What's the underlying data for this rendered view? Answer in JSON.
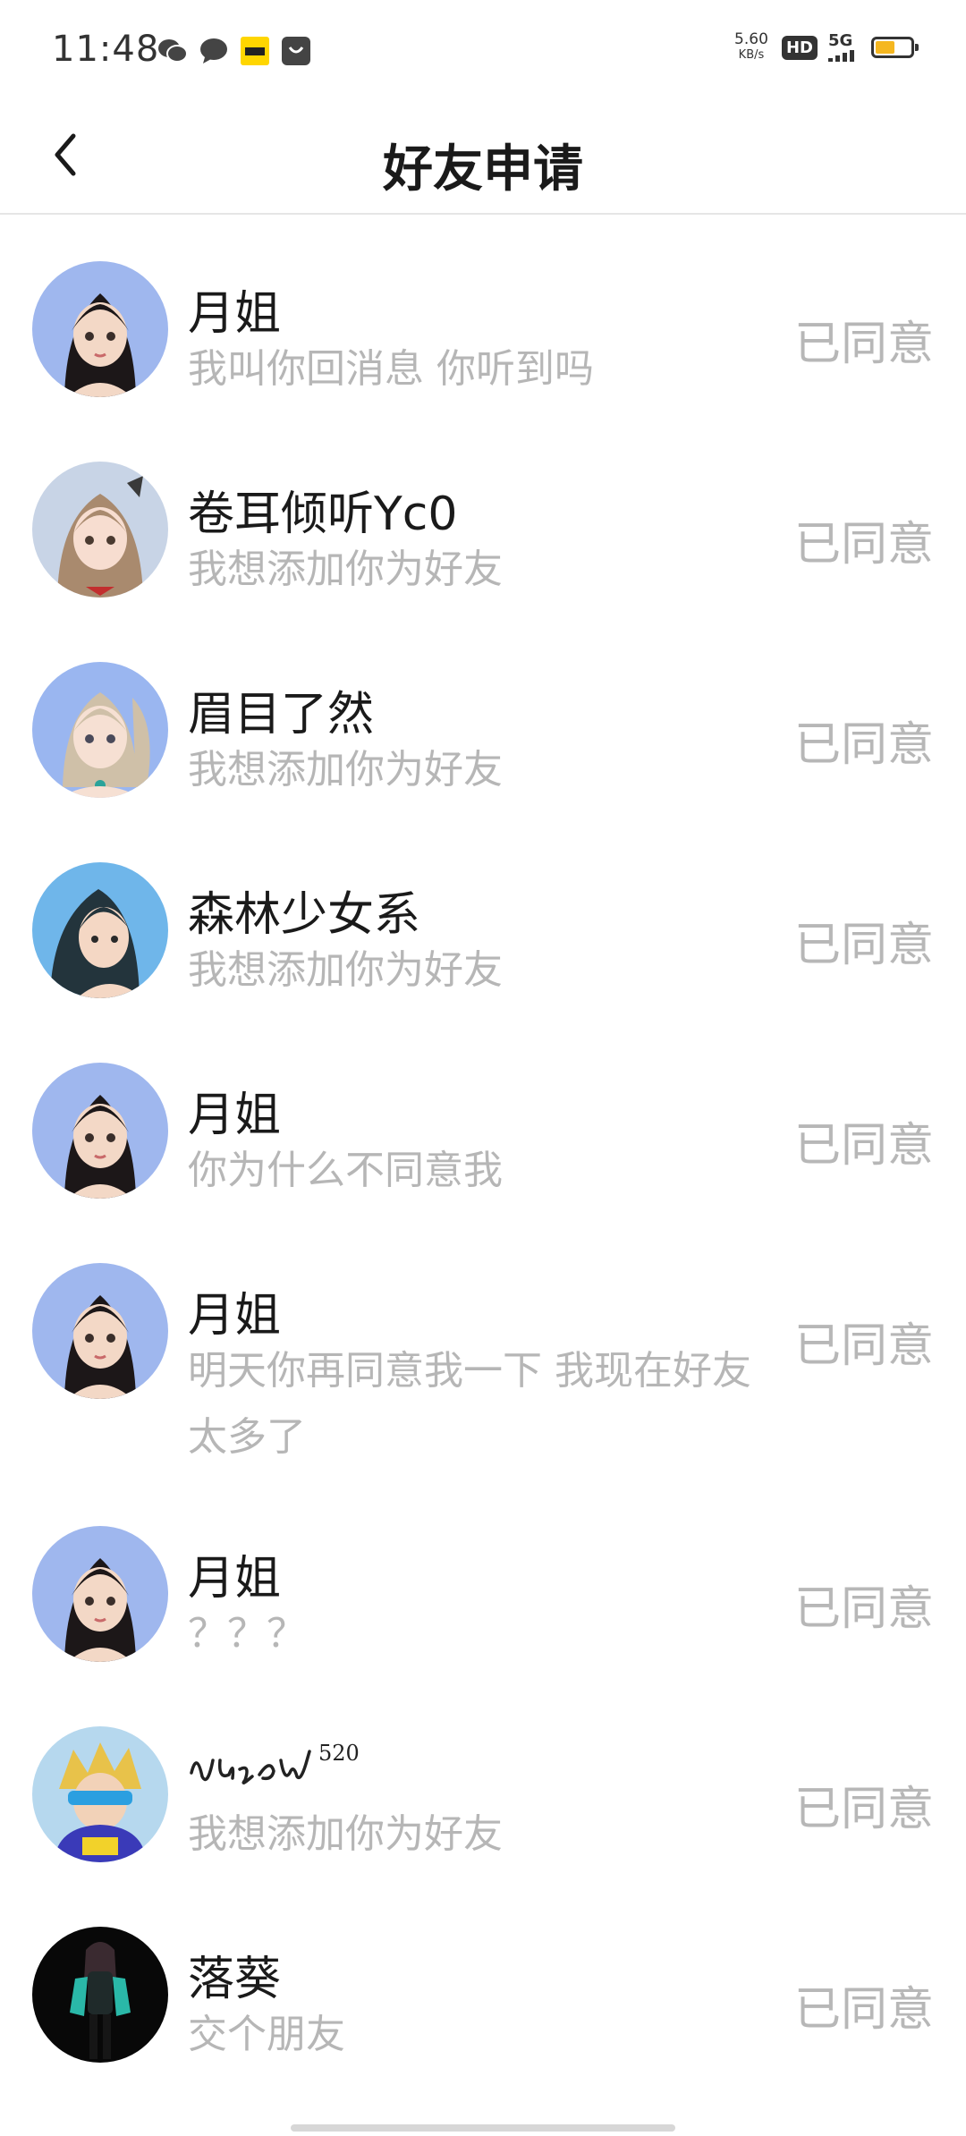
{
  "status_bar": {
    "time": "11:48",
    "speed_value": "5.60",
    "speed_unit": "KB/s",
    "hd": "HD",
    "network": "5G",
    "notification_icons": [
      "wechat-icon",
      "message-icon",
      "kuaishou-app-icon",
      "shopping-app-icon"
    ],
    "battery_level": 0.55
  },
  "header": {
    "title": "好友申请"
  },
  "requests": [
    {
      "name": "月姐",
      "message": "我叫你回消息 你听到吗",
      "status": "已同意",
      "avatar": "avatar-anime-woman-blue"
    },
    {
      "name": "卷耳倾听Yc0",
      "message": "我想添加你为好友",
      "status": "已同意",
      "avatar": "avatar-anime-girl-brown"
    },
    {
      "name": "眉目了然",
      "message": "我想添加你为好友",
      "status": "已同意",
      "avatar": "avatar-anime-girl-blonde"
    },
    {
      "name": "森林少女系",
      "message": "我想添加你为好友",
      "status": "已同意",
      "avatar": "avatar-anime-girl-sky"
    },
    {
      "name": "月姐",
      "message": "你为什么不同意我",
      "status": "已同意",
      "avatar": "avatar-anime-woman-blue"
    },
    {
      "name": "月姐",
      "message": "明天你再同意我一下 我现在好友太多了",
      "status": "已同意",
      "avatar": "avatar-anime-woman-blue"
    },
    {
      "name": "月姐",
      "message": "？？？",
      "status": "已同意",
      "avatar": "avatar-anime-woman-blue"
    },
    {
      "name": "",
      "message": "我想添加你为好友",
      "status": "已同意",
      "avatar": "avatar-anime-boy-yellow",
      "name_image": "handwritten-name-520"
    },
    {
      "name": "落葵",
      "message": "交个朋友",
      "status": "已同意",
      "avatar": "avatar-anime-figure-dark"
    }
  ]
}
